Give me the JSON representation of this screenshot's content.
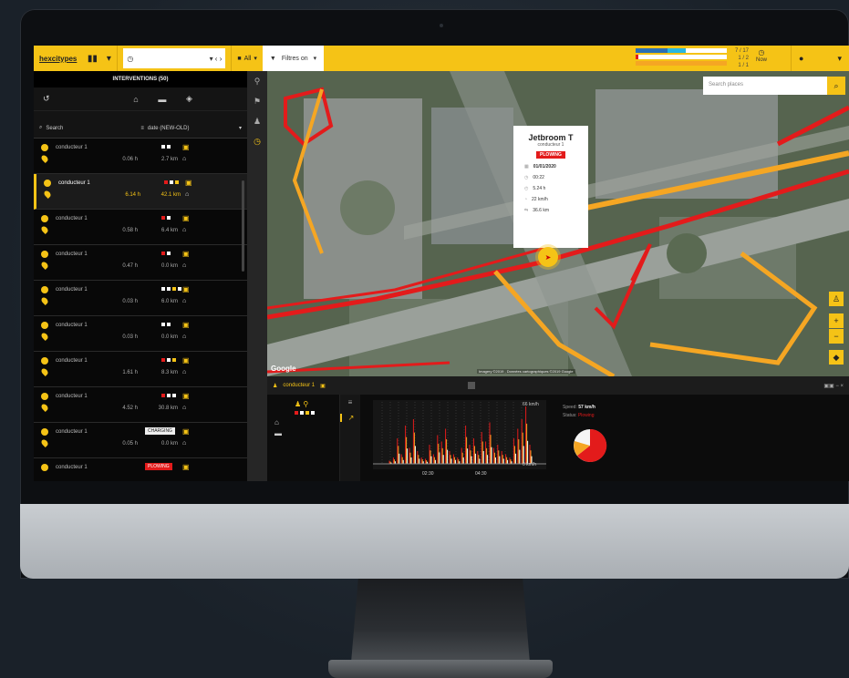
{
  "topbar": {
    "logo": "hexcitypes",
    "filter_label": "Filtres on",
    "all_label": "All",
    "bar_counts": [
      "7 / 17",
      "1 / 2",
      "1 / 1"
    ],
    "now_label": "Now",
    "bar_colors": [
      "#2b6fb3",
      "#e31b1b",
      "#f5a623"
    ]
  },
  "left": {
    "title": "INTERVENTIONS (50)",
    "search_label": "Search",
    "sort_label": "date (NEW-OLD)",
    "items": [
      {
        "name": "conducteur 1",
        "dur": "0.06 h",
        "dist": "2.7 km"
      },
      {
        "name": "conducteur 1",
        "dur": "6.14 h",
        "dist": "42.1 km"
      },
      {
        "name": "conducteur 1",
        "dur": "0.58 h",
        "dist": "6.4 km"
      },
      {
        "name": "conducteur 1",
        "dur": "0.47 h",
        "dist": "0.0 km"
      },
      {
        "name": "conducteur 1",
        "dur": "0.03 h",
        "dist": "6.0 km"
      },
      {
        "name": "conducteur 1",
        "dur": "0.03 h",
        "dist": "0.0 km"
      },
      {
        "name": "conducteur 1",
        "dur": "1.61 h",
        "dist": "8.3 km"
      },
      {
        "name": "conducteur 1",
        "dur": "4.52 h",
        "dist": "30.8 km"
      },
      {
        "name": "conducteur 1",
        "dur": "0.05 h",
        "dist": "0.0 km",
        "badge": "CHARGING"
      },
      {
        "name": "conducteur 1",
        "badge": "PLOWING"
      }
    ]
  },
  "map": {
    "search_placeholder": "Search places",
    "google": "Google",
    "attribution": "Imagery ©2019 , Données cartographiques ©2019 Google",
    "popup": {
      "title": "Jetbroom T",
      "subtitle": "conducteur 1",
      "status": "PLOWING",
      "date": "01/01/2020",
      "time": "00:22",
      "duration": "5.24 h",
      "speed": "22 km/h",
      "distance": "36.6 km"
    }
  },
  "bottom": {
    "driver": "conducteur 1",
    "speed_label": "Speed:",
    "speed_value": "57 km/h",
    "status_label": "Status:",
    "status_value": "Plowing",
    "ymax": "66 km/h",
    "ymin": "0 km/h",
    "x_ticks": [
      "02:30",
      "04:30"
    ]
  }
}
